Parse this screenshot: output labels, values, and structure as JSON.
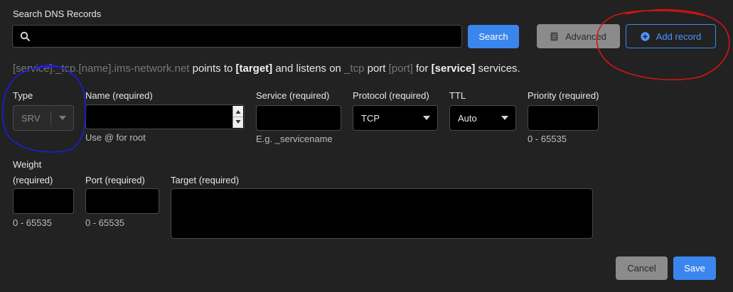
{
  "search": {
    "label": "Search DNS Records",
    "value": "",
    "button": "Search"
  },
  "toolbar": {
    "advanced": "Advanced",
    "add_record": "Add record"
  },
  "sentence": {
    "service": "[service]",
    "tcp1": "._tcp.",
    "name": "[name]",
    "domain": ".ims-network.net",
    "points_to": " points to ",
    "target": "[target]",
    "listens_on": " and listens on ",
    "tcp2": "_tcp",
    "port_word": " port ",
    "port": "[port]",
    "for": " for ",
    "service2": "[service]",
    "services": " services."
  },
  "form": {
    "type": {
      "label": "Type",
      "value": "SRV"
    },
    "name": {
      "label": "Name (required)",
      "value": "",
      "help": "Use @ for root"
    },
    "service": {
      "label": "Service (required)",
      "value": "",
      "help": "E.g. _servicename"
    },
    "protocol": {
      "label": "Protocol (required)",
      "value": "TCP"
    },
    "ttl": {
      "label": "TTL",
      "value": "Auto"
    },
    "priority": {
      "label": "Priority (required)",
      "value": "",
      "help": "0 - 65535"
    },
    "weight": {
      "label_line1": "Weight",
      "label_line2": "(required)",
      "value": "",
      "help": "0 - 65535"
    },
    "port": {
      "label": "Port (required)",
      "value": "",
      "help": "0 - 65535"
    },
    "target": {
      "label": "Target (required)",
      "value": ""
    }
  },
  "actions": {
    "cancel": "Cancel",
    "save": "Save"
  },
  "colors": {
    "background": "#222222",
    "primary": "#3b86ee",
    "annotation_red": "#d41414",
    "annotation_blue": "#1d1de0"
  },
  "icons": [
    "search-icon",
    "document-icon",
    "plus-circle-icon",
    "chevron-down-icon",
    "spinner-arrows-icon"
  ]
}
